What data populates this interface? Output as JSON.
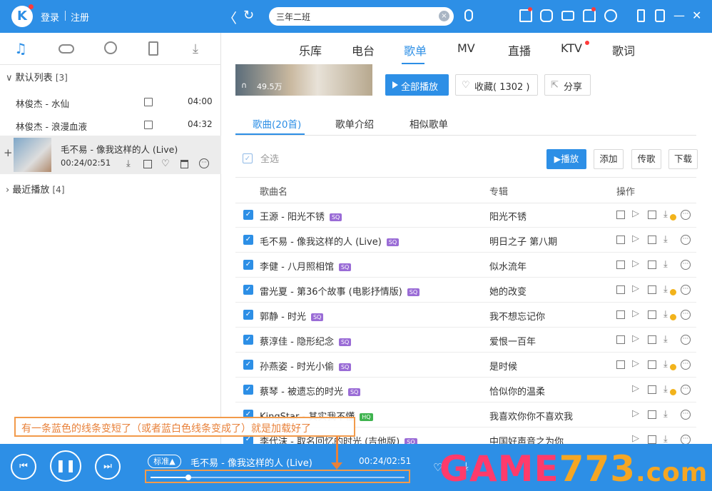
{
  "topbar": {
    "logo_letter": "K",
    "login": "登录",
    "register": "注册",
    "search_value": "三年二班",
    "search_clear": "×",
    "back": "〈",
    "refresh": "↻"
  },
  "left": {
    "default_list": {
      "label": "默认列表",
      "count": "[3]"
    },
    "songs": [
      {
        "name": "林俊杰 - 水仙",
        "duration": "04:00"
      },
      {
        "name": "林俊杰 - 浪漫血液",
        "duration": "04:32"
      }
    ],
    "playing": {
      "title": "毛不易 - 像我这样的人 (Live)",
      "time": "00:24/02:51"
    },
    "recent": {
      "label": "最近播放",
      "count": "[4]"
    }
  },
  "nav": {
    "tabs": [
      "乐库",
      "电台",
      "歌单",
      "MV",
      "直播",
      "KTV",
      "歌词"
    ],
    "active": "歌单"
  },
  "playlist": {
    "play_count": "49.5万",
    "play_all": "全部播放",
    "favorite": "收藏( 1302 )",
    "share": "分享"
  },
  "subtabs": {
    "songs": "歌曲(20首)",
    "intro": "歌单介绍",
    "similar": "相似歌单"
  },
  "toolbar": {
    "select_all": "全选",
    "play": "播放",
    "add": "添加",
    "send": "传歌",
    "download": "下载"
  },
  "table": {
    "headers": {
      "name": "歌曲名",
      "album": "专辑",
      "ops": "操作"
    },
    "rows": [
      {
        "name": "王源 - 阳光不锈",
        "badge": "SQ",
        "album": "阳光不锈",
        "mv": true,
        "vip": true
      },
      {
        "name": "毛不易 - 像我这样的人 (Live)",
        "badge": "SQ",
        "album": "明日之子 第八期",
        "mv": true,
        "vip": false
      },
      {
        "name": "李健 - 八月照相馆",
        "badge": "SQ",
        "album": "似水流年",
        "mv": true,
        "vip": false
      },
      {
        "name": "雷光夏 - 第36个故事 (电影抒情版)",
        "badge": "SQ",
        "album": "她的改变",
        "mv": true,
        "vip": true
      },
      {
        "name": "郭静 - 时光",
        "badge": "SQ",
        "album": "我不想忘记你",
        "mv": true,
        "vip": true
      },
      {
        "name": "蔡淳佳 - 隐形纪念",
        "badge": "SQ",
        "album": "爱恨一百年",
        "mv": true,
        "vip": false
      },
      {
        "name": "孙燕姿 - 时光小偷",
        "badge": "SQ",
        "album": "是时候",
        "mv": true,
        "vip": true
      },
      {
        "name": "蔡琴 - 被遗忘的时光",
        "badge": "SQ",
        "album": "恰似你的温柔",
        "mv": false,
        "vip": true
      },
      {
        "name": "KingStar - 其实我不懂",
        "badge": "HQ",
        "album": "我喜欢你你不喜欢我",
        "mv": false,
        "vip": false
      },
      {
        "name": "李代沫 - 取名回忆的时光 (吉他版)",
        "badge": "SQ",
        "album": "中国好声音之为你",
        "mv": false,
        "vip": false
      }
    ]
  },
  "player": {
    "quality": "标准▲",
    "title": "毛不易 - 像我这样的人 (Live)",
    "time": "00:24/02:51",
    "progress": 0.15
  },
  "annotation": "有一条蓝色的线条变短了（或者蓝白色线条变成了）就是加载好了",
  "watermark": {
    "g": "G",
    "a": "A",
    "m": "M",
    "e": "E",
    "n": "773",
    ".com": ".com"
  },
  "colors": {
    "accent": "#2d8fe6",
    "annot": "#e8813a"
  }
}
